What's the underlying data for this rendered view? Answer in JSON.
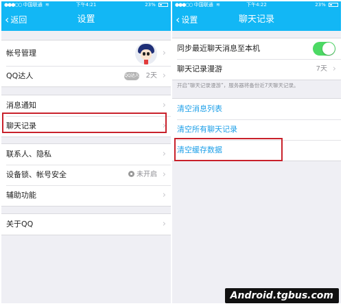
{
  "left": {
    "status": {
      "carrier": "中国联通",
      "time": "下午4:21",
      "battery": "23%"
    },
    "nav": {
      "back_label": "返回",
      "title": "设置"
    },
    "items": [
      {
        "label": "帐号管理"
      },
      {
        "label": "QQ达人",
        "badge": "QQ达人",
        "value": "2天"
      },
      {
        "label": "消息通知"
      },
      {
        "label": "聊天记录"
      },
      {
        "label": "联系人、隐私"
      },
      {
        "label": "设备锁、帐号安全",
        "value": "未开启"
      },
      {
        "label": "辅助功能"
      },
      {
        "label": "关于QQ"
      }
    ]
  },
  "right": {
    "status": {
      "carrier": "中国联通",
      "time": "下午4:22",
      "battery": "23%"
    },
    "nav": {
      "back_label": "设置",
      "title": "聊天记录"
    },
    "sync": {
      "label": "同步最近聊天消息至本机",
      "enabled": true
    },
    "roam": {
      "label": "聊天记录漫游",
      "value": "7天"
    },
    "hint": "开启“聊天记录漫游”，服务器将备份近7天聊天记录。",
    "actions": [
      {
        "label": "清空消息列表"
      },
      {
        "label": "清空所有聊天记录"
      },
      {
        "label": "清空缓存数据"
      }
    ]
  },
  "watermark": "Android.tgbus.com",
  "colors": {
    "nav": "#12b7f5",
    "link": "#1c9fe8",
    "highlight": "#c8202a",
    "toggle_on": "#4cd964"
  }
}
